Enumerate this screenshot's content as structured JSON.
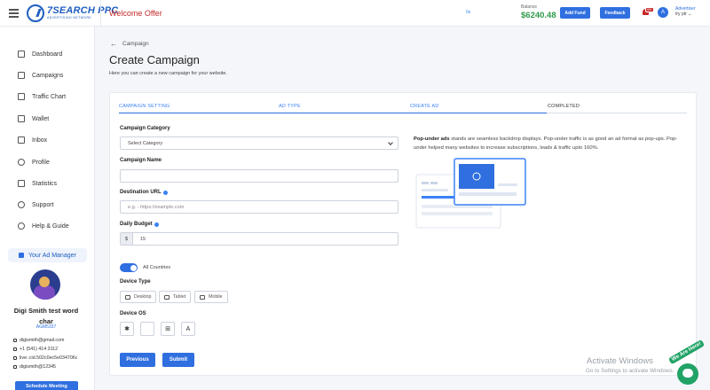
{
  "topbar": {
    "logo_main": "7SEARCH PPC",
    "logo_sub": "ADVERTISING NETWORK",
    "welcome": "Welcome Offer",
    "small_label": "0s",
    "balance_label": "Balance",
    "balance_value": "$6240.48",
    "add_fund": "Add Fund",
    "feedback": "Feedback",
    "bell_badge": "99+",
    "avatar_letter": "A",
    "user_role": "Advertiser",
    "user_name": "try ptr"
  },
  "sidebar": {
    "items": [
      {
        "label": "Dashboard",
        "icon": "home-icon"
      },
      {
        "label": "Campaigns",
        "icon": "campaigns-icon"
      },
      {
        "label": "Traffic Chart",
        "icon": "chart-icon"
      },
      {
        "label": "Wallet",
        "icon": "wallet-icon"
      },
      {
        "label": "Inbox",
        "icon": "inbox-icon"
      },
      {
        "label": "Profile",
        "icon": "profile-icon"
      },
      {
        "label": "Statistics",
        "icon": "statistics-icon"
      },
      {
        "label": "Support",
        "icon": "support-icon"
      },
      {
        "label": "Help & Guide",
        "icon": "help-icon"
      }
    ],
    "ad_manager": "Your Ad Manager",
    "manager_name": "Digi Smith test word char",
    "manager_id": "AGM5337",
    "contacts": [
      "digismith@gmail.com",
      "+1 (541) 414 3112",
      "live:.cid.502c0ec5e034706c",
      "digismith@12345"
    ],
    "schedule": "Schedule Meeting"
  },
  "main": {
    "breadcrumb": "Campaign",
    "title": "Create Campaign",
    "subtitle": "Here you can create a new campaign for your website.",
    "steps": [
      "CAMPAIGN SETTING",
      "AD TYPE",
      "CREATE AD",
      "COMPLETED"
    ],
    "form": {
      "category_label": "Campaign Category",
      "category_value": "Select Category",
      "name_label": "Campaign Name",
      "name_value": "",
      "url_label": "Destination URL",
      "url_placeholder": "e.g. - https://example.com",
      "budget_label": "Daily Budget",
      "budget_prefix": "$",
      "budget_value": "15",
      "countries_label": "All Countries",
      "device_type_label": "Device Type",
      "devices": [
        "Desktop",
        "Tablet",
        "Mobile"
      ],
      "device_os_label": "Device OS",
      "os_icons": [
        "android-icon",
        "apple-icon",
        "windows-icon",
        "linux-icon"
      ],
      "previous": "Previous",
      "submit": "Submit"
    },
    "description_bold": "Pop-under ads",
    "description_rest": " stands are seamless backdrop displays. Pop-under traffic is as good an ad format as pop-ups. Pop-under helped many websites to increase subscriptions, leads & traffic upto 160%."
  },
  "overlay": {
    "activate": "Activate Windows",
    "activate_sub": "Go to Settings to activate Windows.",
    "chat_badge": "We Are Here!"
  }
}
